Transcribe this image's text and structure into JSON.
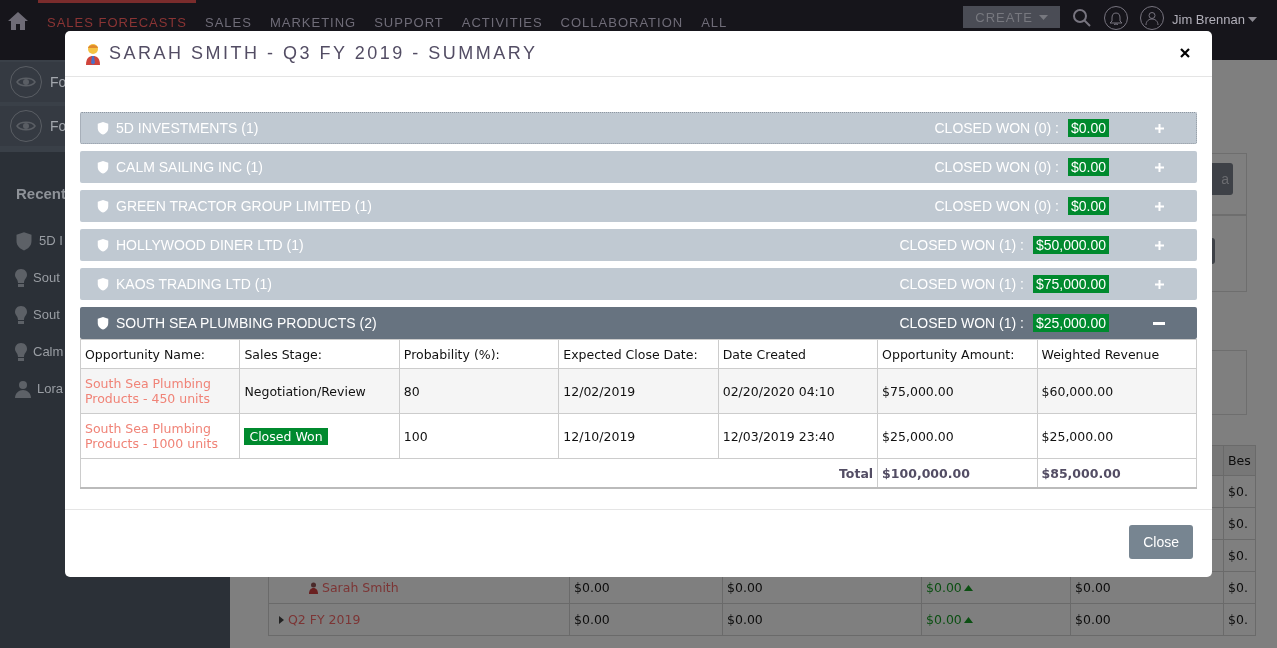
{
  "top_nav": {
    "tabs": [
      {
        "label": "SALES FORECASTS",
        "selected": true
      },
      {
        "label": "SALES",
        "selected": false
      },
      {
        "label": "MARKETING",
        "selected": false
      },
      {
        "label": "SUPPORT",
        "selected": false
      },
      {
        "label": "ACTIVITIES",
        "selected": false
      },
      {
        "label": "COLLABORATION",
        "selected": false
      },
      {
        "label": "ALL",
        "selected": false
      }
    ],
    "create_button": "CREATE",
    "user_name": "Jim Brennan"
  },
  "sidebar": {
    "actions": [
      "Fo",
      "Fo"
    ],
    "recent_heading": "Recent",
    "recent_items": [
      {
        "label": "5D I",
        "kind": "account"
      },
      {
        "label": "Sout",
        "kind": "opportunity"
      },
      {
        "label": "Sout",
        "kind": "opportunity"
      },
      {
        "label": "Calm",
        "kind": "opportunity"
      },
      {
        "label": "Lora",
        "kind": "contact"
      }
    ]
  },
  "background": {
    "side_button": "a",
    "table": {
      "last_heading": "Bes",
      "rows": [
        {
          "cells": [
            "$0."
          ]
        },
        {
          "cells": [
            "$0."
          ]
        },
        {
          "cells": [
            "$0."
          ]
        },
        {
          "name": "Sarah Smith",
          "kind": "person",
          "cells": [
            "$0.00",
            "$0.00",
            {
              "text": "$0.00",
              "kind": "up"
            },
            "$0.00",
            "$0."
          ]
        },
        {
          "name": "Q2 FY 2019",
          "kind": "period",
          "cells": [
            "$0.00",
            "$0.00",
            {
              "text": "$0.00",
              "kind": "up"
            },
            "$0.00",
            "$0."
          ]
        }
      ]
    }
  },
  "modal": {
    "title": "SARAH SMITH - Q3 FY 2019 - SUMMARY",
    "groups": [
      {
        "name": "5D INVESTMENTS (1)",
        "summary": "CLOSED WON (0) :",
        "amount": "$0.00",
        "expanded": false,
        "focused": true
      },
      {
        "name": "CALM SAILING INC (1)",
        "summary": "CLOSED WON (0) :",
        "amount": "$0.00",
        "expanded": false,
        "focused": false
      },
      {
        "name": "GREEN TRACTOR GROUP LIMITED (1)",
        "summary": "CLOSED WON (0) :",
        "amount": "$0.00",
        "expanded": false,
        "focused": false
      },
      {
        "name": "HOLLYWOOD DINER LTD (1)",
        "summary": "CLOSED WON (1) :",
        "amount": "$50,000.00",
        "expanded": false,
        "focused": false
      },
      {
        "name": "KAOS TRADING LTD (1)",
        "summary": "CLOSED WON (1) :",
        "amount": "$75,000.00",
        "expanded": false,
        "focused": false
      },
      {
        "name": "SOUTH SEA PLUMBING PRODUCTS (2)",
        "summary": "CLOSED WON (1) :",
        "amount": "$25,000.00",
        "expanded": true,
        "focused": false
      }
    ],
    "table": {
      "columns": [
        "Opportunity Name:",
        "Sales Stage:",
        "Probability (%):",
        "Expected Close Date:",
        "Date Created",
        "Opportunity Amount:",
        "Weighted Revenue"
      ],
      "rows": [
        {
          "name": "South Sea Plumbing Products - 450 units",
          "stage": "Negotiation/Review",
          "kind": "open",
          "probability": "80",
          "close_date": "12/02/2019",
          "created": "02/20/2020 04:10",
          "amount": "$75,000.00",
          "weighted": "$60,000.00"
        },
        {
          "name": "South Sea Plumbing Products - 1000 units",
          "stage": "Closed Won",
          "kind": "won",
          "probability": "100",
          "close_date": "12/10/2019",
          "created": "12/03/2019 23:40",
          "amount": "$25,000.00",
          "weighted": "$25,000.00"
        }
      ],
      "total_label": "Total",
      "totals": [
        "$100,000.00",
        "$85,000.00"
      ]
    },
    "close_button": "Close"
  }
}
